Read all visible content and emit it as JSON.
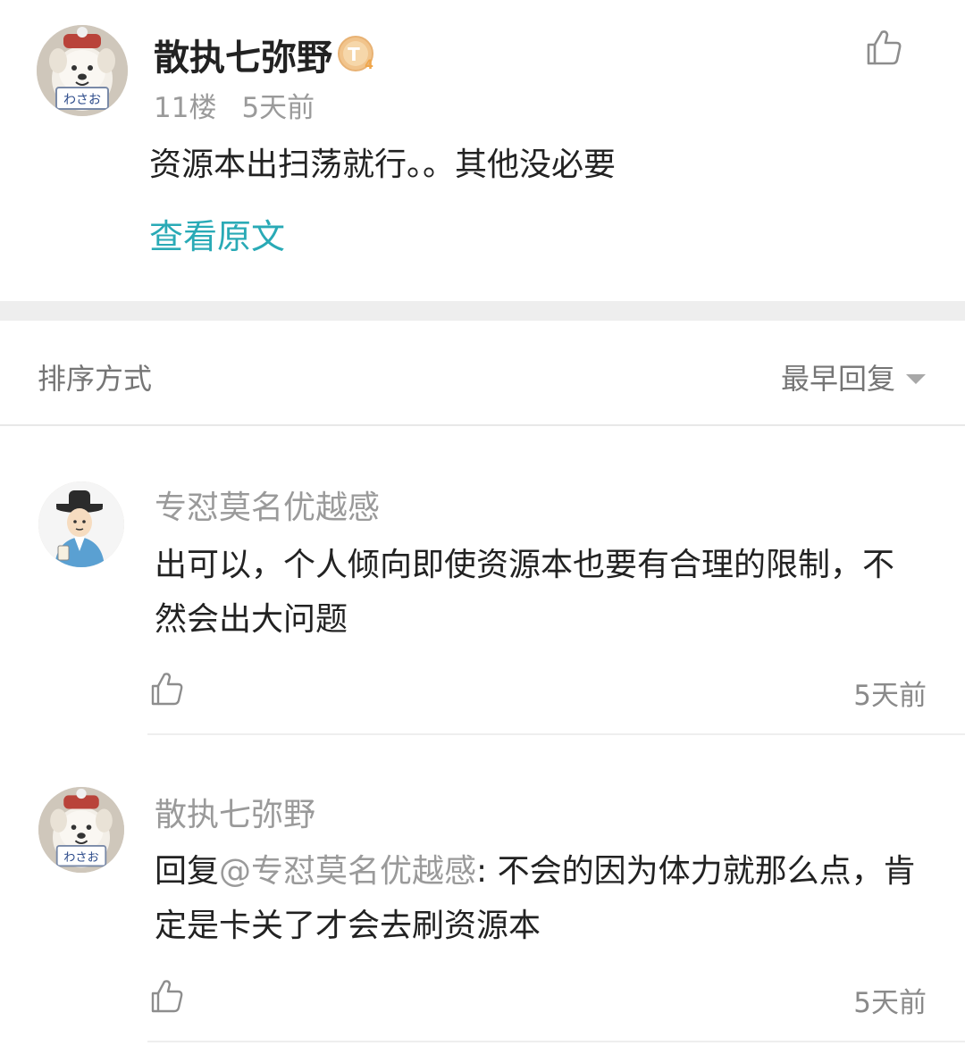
{
  "main_post": {
    "author": "散执七弥野",
    "level_badge_text": "T4",
    "floor": "11楼",
    "time": "5天前",
    "content": "资源本出扫荡就行。。其他没必要",
    "view_original": "查看原文"
  },
  "sort": {
    "label": "排序方式",
    "selected": "最早回复"
  },
  "replies": [
    {
      "author": "专怼莫名优越感",
      "content": "出可以，个人倾向即使资源本也要有合理的限制，不然会出大问题",
      "time": "5天前"
    },
    {
      "author": "散执七弥野",
      "reply_prefix": "回复",
      "mention": "@专怼莫名优越感",
      "content": ": 不会的因为体力就那么点，肯定是卡关了才会去刷资源本",
      "time": "5天前"
    }
  ],
  "colors": {
    "accent": "#29aab6",
    "muted_text": "#9a9a9a",
    "primary_text": "#222222",
    "separator": "#eeeeee"
  },
  "icons": {
    "like": "thumbs-up-icon",
    "sort_caret": "caret-down-icon",
    "level": "level-badge-icon"
  }
}
